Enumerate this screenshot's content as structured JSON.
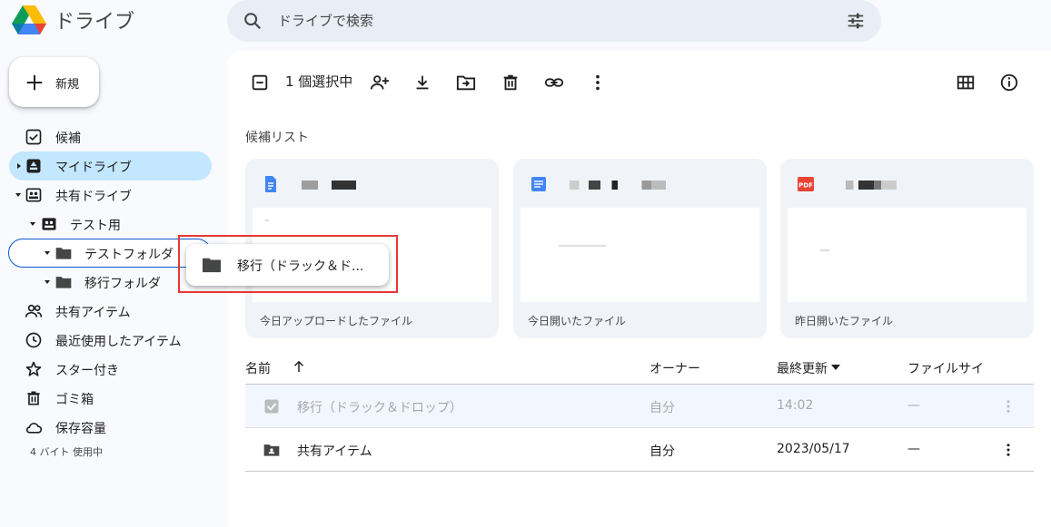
{
  "app": {
    "name": "ドライブ"
  },
  "search": {
    "placeholder": "ドライブで検索"
  },
  "new_button": {
    "label": "新規"
  },
  "nav": {
    "candidates": "候補",
    "my_drive": "マイドライブ",
    "shared_drives": "共有ドライブ",
    "test_drive": "テスト用",
    "test_folder": "テストフォルダ",
    "move_folder": "移行フォルダ",
    "shared_with_me": "共有アイテム",
    "recent": "最近使用したアイテム",
    "starred": "スター付き",
    "trash": "ゴミ箱",
    "storage": "保存容量",
    "storage_used": "4 バイト 使用中"
  },
  "toolbar": {
    "selection": "1 個選択中"
  },
  "suggestions": {
    "title": "候補リスト",
    "cards": [
      {
        "reason": "今日アップロードしたファイル",
        "icon": "docs-icon"
      },
      {
        "reason": "今日開いたファイル",
        "icon": "docs-icon"
      },
      {
        "reason": "昨日開いたファイル",
        "icon": "pdf-icon",
        "badge": "PDF"
      }
    ]
  },
  "table": {
    "headers": {
      "name": "名前",
      "owner": "オーナー",
      "modified": "最終更新",
      "size": "ファイルサイ"
    },
    "rows": [
      {
        "name": "移行（ドラック＆ドロップ）",
        "owner": "自分",
        "modified": "14:02",
        "size": "—"
      },
      {
        "name": "共有アイテム",
        "owner": "自分",
        "modified": "2023/05/17",
        "size": "—"
      }
    ]
  },
  "drag_ghost": {
    "label": "移行（ドラック＆ド..."
  },
  "colors": {
    "accent": "#0b57d0",
    "active_bg": "#c2e7ff",
    "highlight": "#e53935"
  }
}
